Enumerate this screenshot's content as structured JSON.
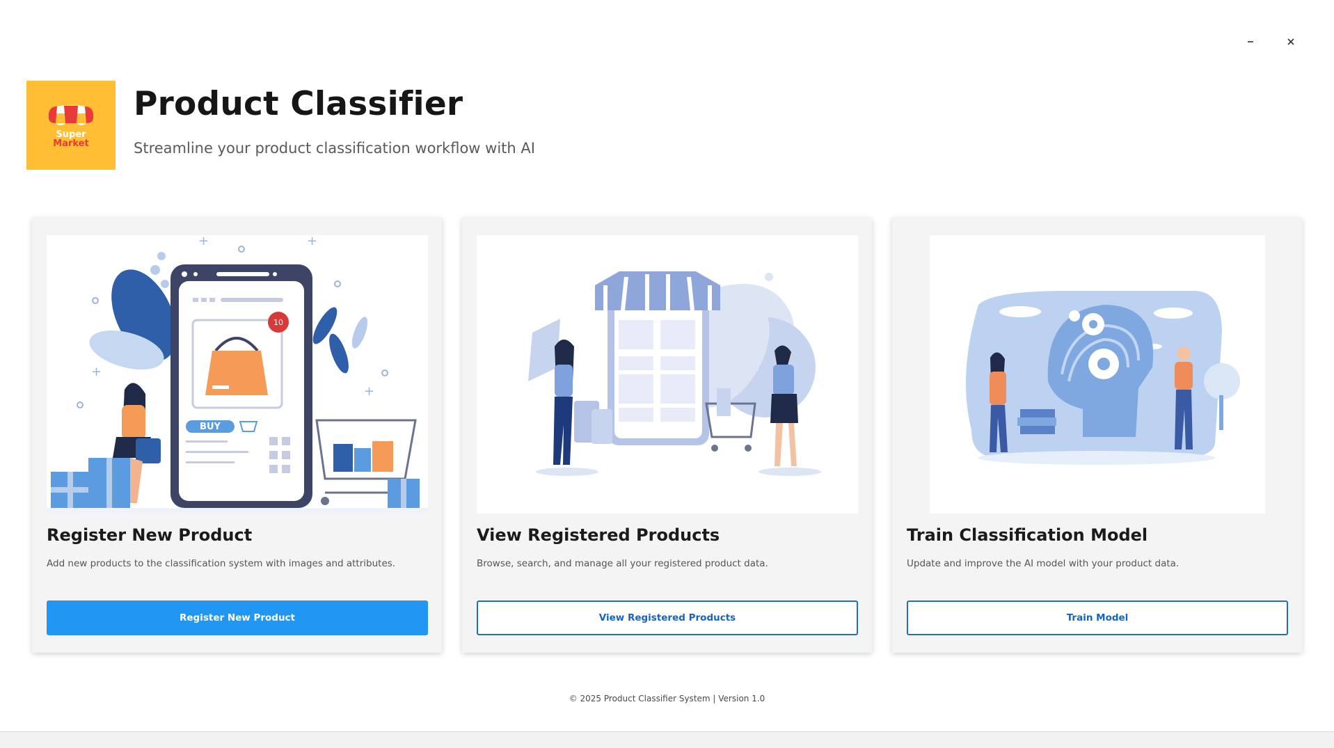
{
  "window": {
    "minimize_icon": "minimize-icon",
    "close_icon": "close-icon"
  },
  "header": {
    "logo_line1": "Super",
    "logo_line2": "Market",
    "title": "Product Classifier",
    "subtitle": "Streamline your product classification workflow with AI"
  },
  "cards": [
    {
      "title": "Register New Product",
      "description": "Add new products to the classification system with images and attributes.",
      "button_label": "Register New Product",
      "button_style": "primary"
    },
    {
      "title": "View Registered Products",
      "description": "Browse, search, and manage all your registered product data.",
      "button_label": "View Registered Products",
      "button_style": "outline"
    },
    {
      "title": "Train Classification Model",
      "description": "Update and improve the AI model with your product data.",
      "button_label": "Train Model",
      "button_style": "outline"
    }
  ],
  "illustrations": {
    "card1_phone_badge": "10",
    "card1_buy_label": "BUY"
  },
  "footer": {
    "text": "© 2025 Product Classifier System | Version 1.0"
  },
  "colors": {
    "accent": "#2196f3",
    "outline_button": "#1e6fc4",
    "logo_background": "#ffbe33",
    "card_background": "#f4f4f4"
  }
}
